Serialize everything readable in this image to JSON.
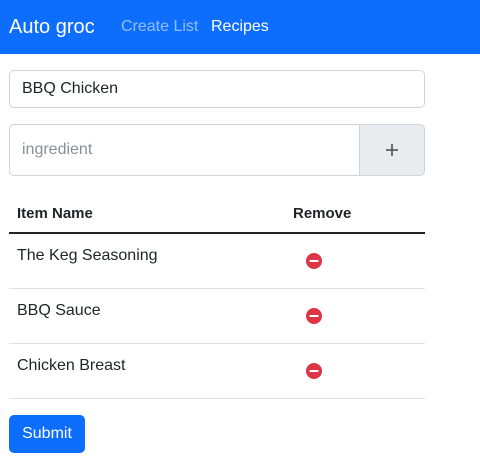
{
  "navbar": {
    "brand": "Auto groc",
    "links": [
      {
        "label": "Create List",
        "active": false
      },
      {
        "label": "Recipes",
        "active": true
      }
    ]
  },
  "form": {
    "recipe_name_value": "BBQ Chicken",
    "ingredient_placeholder": "ingredient",
    "add_icon": "plus-icon"
  },
  "table": {
    "headers": [
      "Item Name",
      "Remove"
    ],
    "rows": [
      {
        "name": "The Keg Seasoning",
        "remove_icon": "dash-circle-fill-icon"
      },
      {
        "name": "BBQ Sauce",
        "remove_icon": "dash-circle-fill-icon"
      },
      {
        "name": "Chicken Breast",
        "remove_icon": "dash-circle-fill-icon"
      }
    ]
  },
  "submit_label": "Submit",
  "colors": {
    "primary": "#0d6efd",
    "danger": "#dc3545",
    "addon_bg": "#e9ecef"
  }
}
